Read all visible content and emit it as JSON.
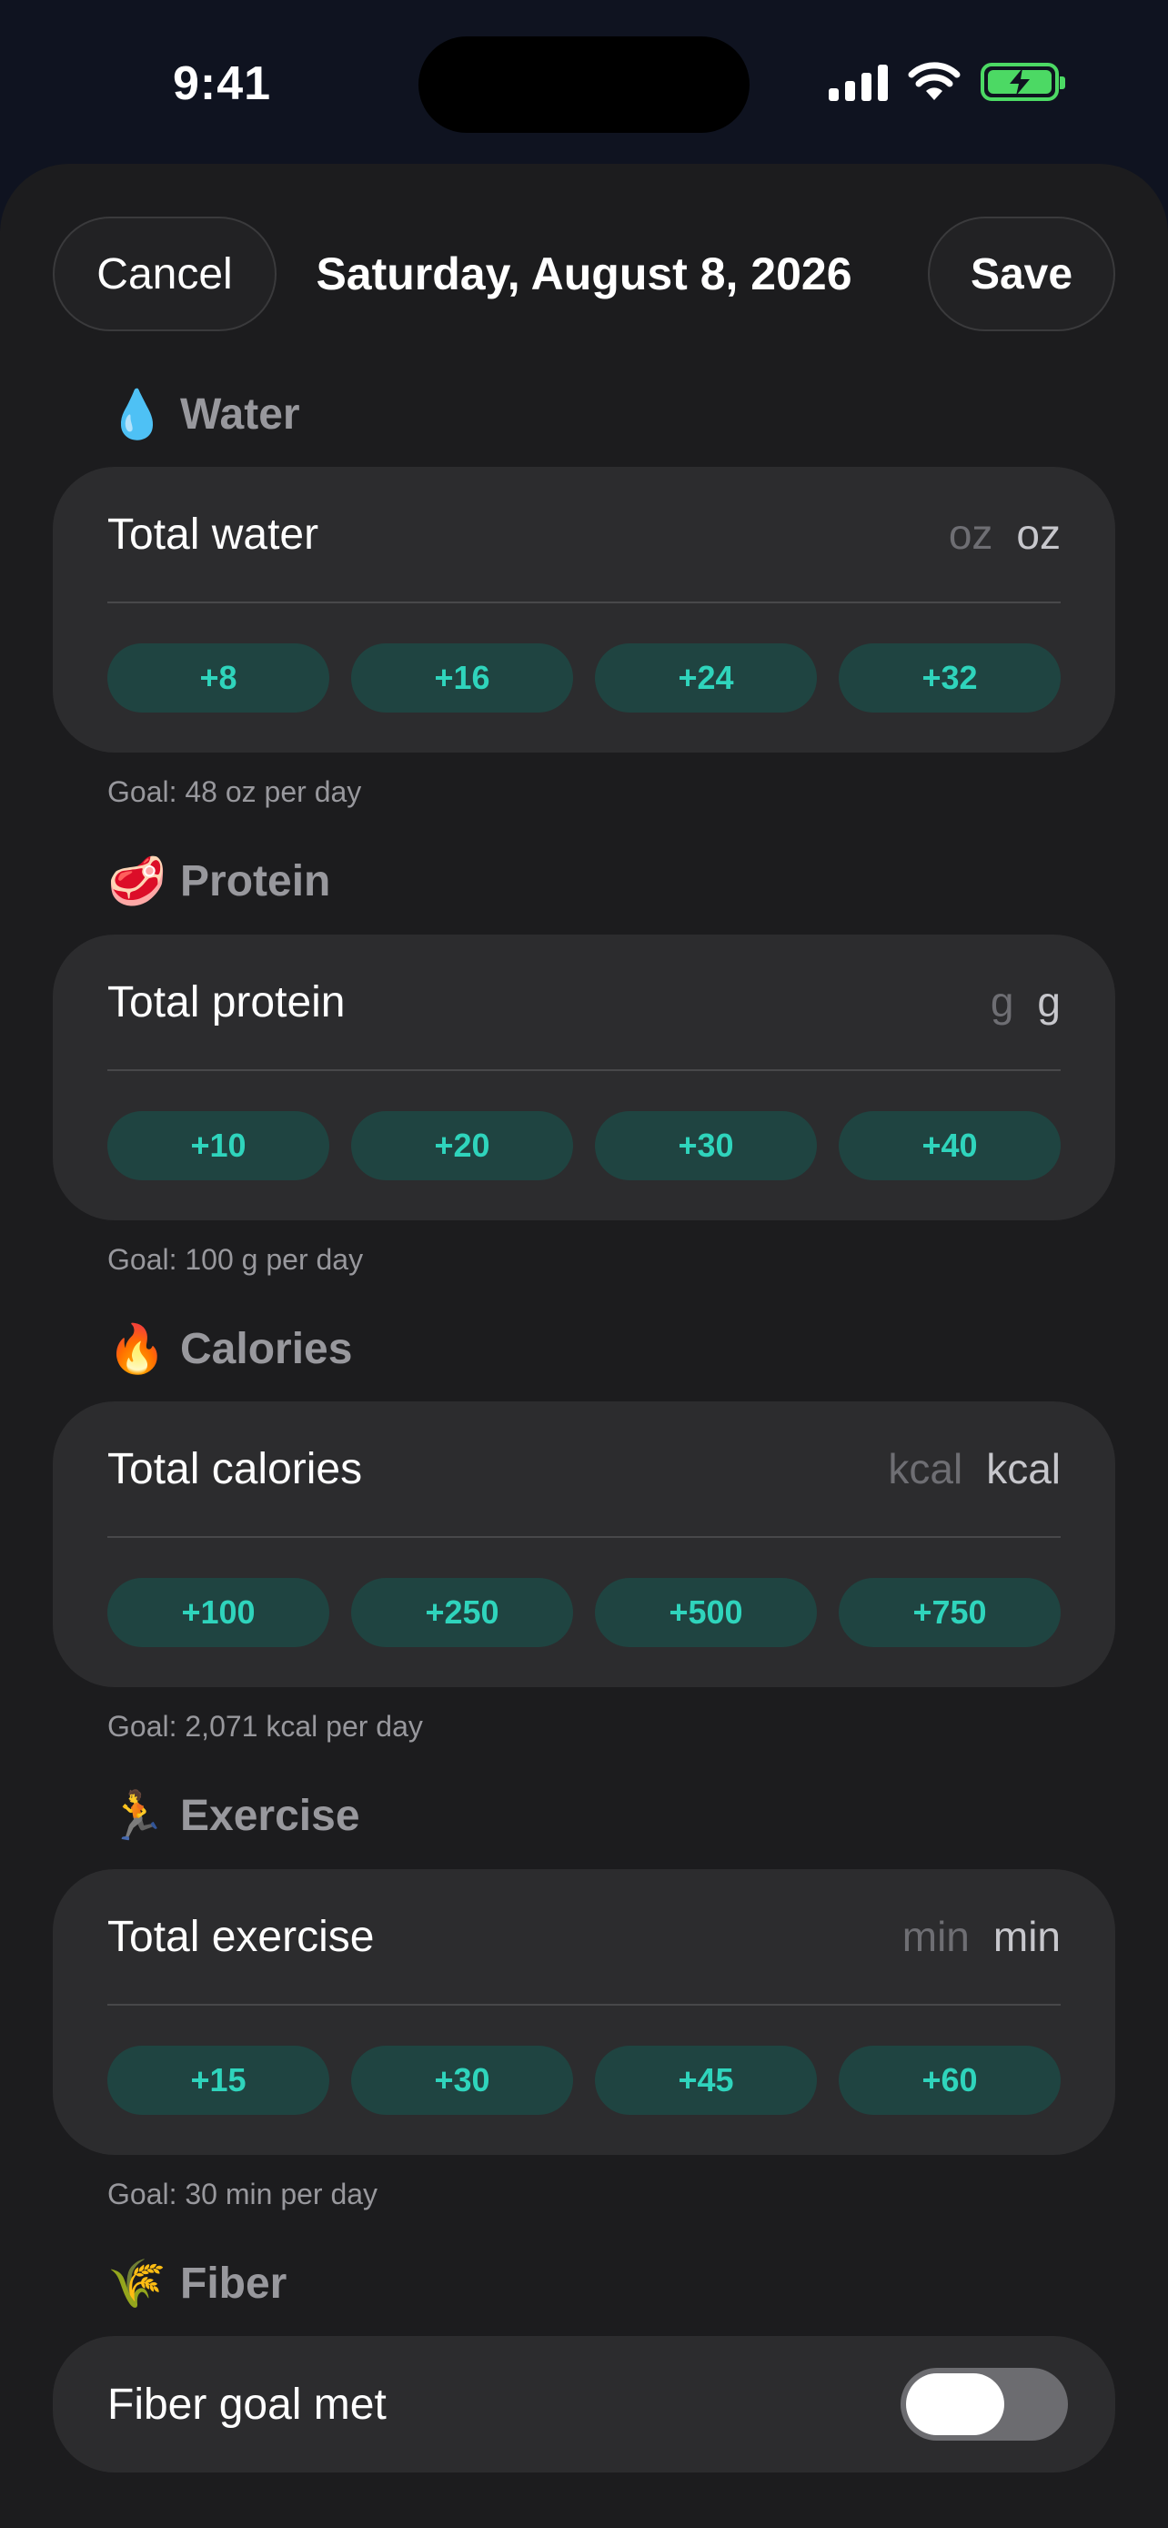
{
  "status_bar": {
    "time": "9:41",
    "icons": [
      "signal-icon",
      "wifi-icon",
      "battery-charging-icon"
    ]
  },
  "nav": {
    "cancel_label": "Cancel",
    "title": "Saturday, August 8, 2026",
    "save_label": "Save"
  },
  "sections": {
    "water": {
      "icon": "water-drop-icon",
      "emoji": "💧",
      "title": "Water",
      "row_label": "Total water",
      "placeholder": "oz",
      "unit": "oz",
      "buttons": [
        "+8",
        "+16",
        "+24",
        "+32"
      ],
      "goal": "Goal: 48 oz per day"
    },
    "protein": {
      "icon": "meat-icon",
      "emoji": "🥩",
      "title": "Protein",
      "row_label": "Total protein",
      "placeholder": "g",
      "unit": "g",
      "buttons": [
        "+10",
        "+20",
        "+30",
        "+40"
      ],
      "goal": "Goal: 100 g per day"
    },
    "calories": {
      "icon": "fire-icon",
      "emoji": "🔥",
      "title": "Calories",
      "row_label": "Total calories",
      "placeholder": "kcal",
      "unit": "kcal",
      "buttons": [
        "+100",
        "+250",
        "+500",
        "+750"
      ],
      "goal": "Goal: 2,071 kcal per day"
    },
    "exercise": {
      "icon": "running-person-icon",
      "emoji": "🏃",
      "title": "Exercise",
      "row_label": "Total exercise",
      "placeholder": "min",
      "unit": "min",
      "buttons": [
        "+15",
        "+30",
        "+45",
        "+60"
      ],
      "goal": "Goal: 30 min per day"
    },
    "fiber": {
      "icon": "wheat-icon",
      "emoji": "🌾",
      "title": "Fiber",
      "toggle_label": "Fiber goal met",
      "toggle_on": false
    }
  },
  "colors": {
    "background": "#1c1c1e",
    "card": "#2c2c2e",
    "accent": "#2fd4bc",
    "accent_bg": "#1f4441",
    "battery": "#4cd964"
  }
}
